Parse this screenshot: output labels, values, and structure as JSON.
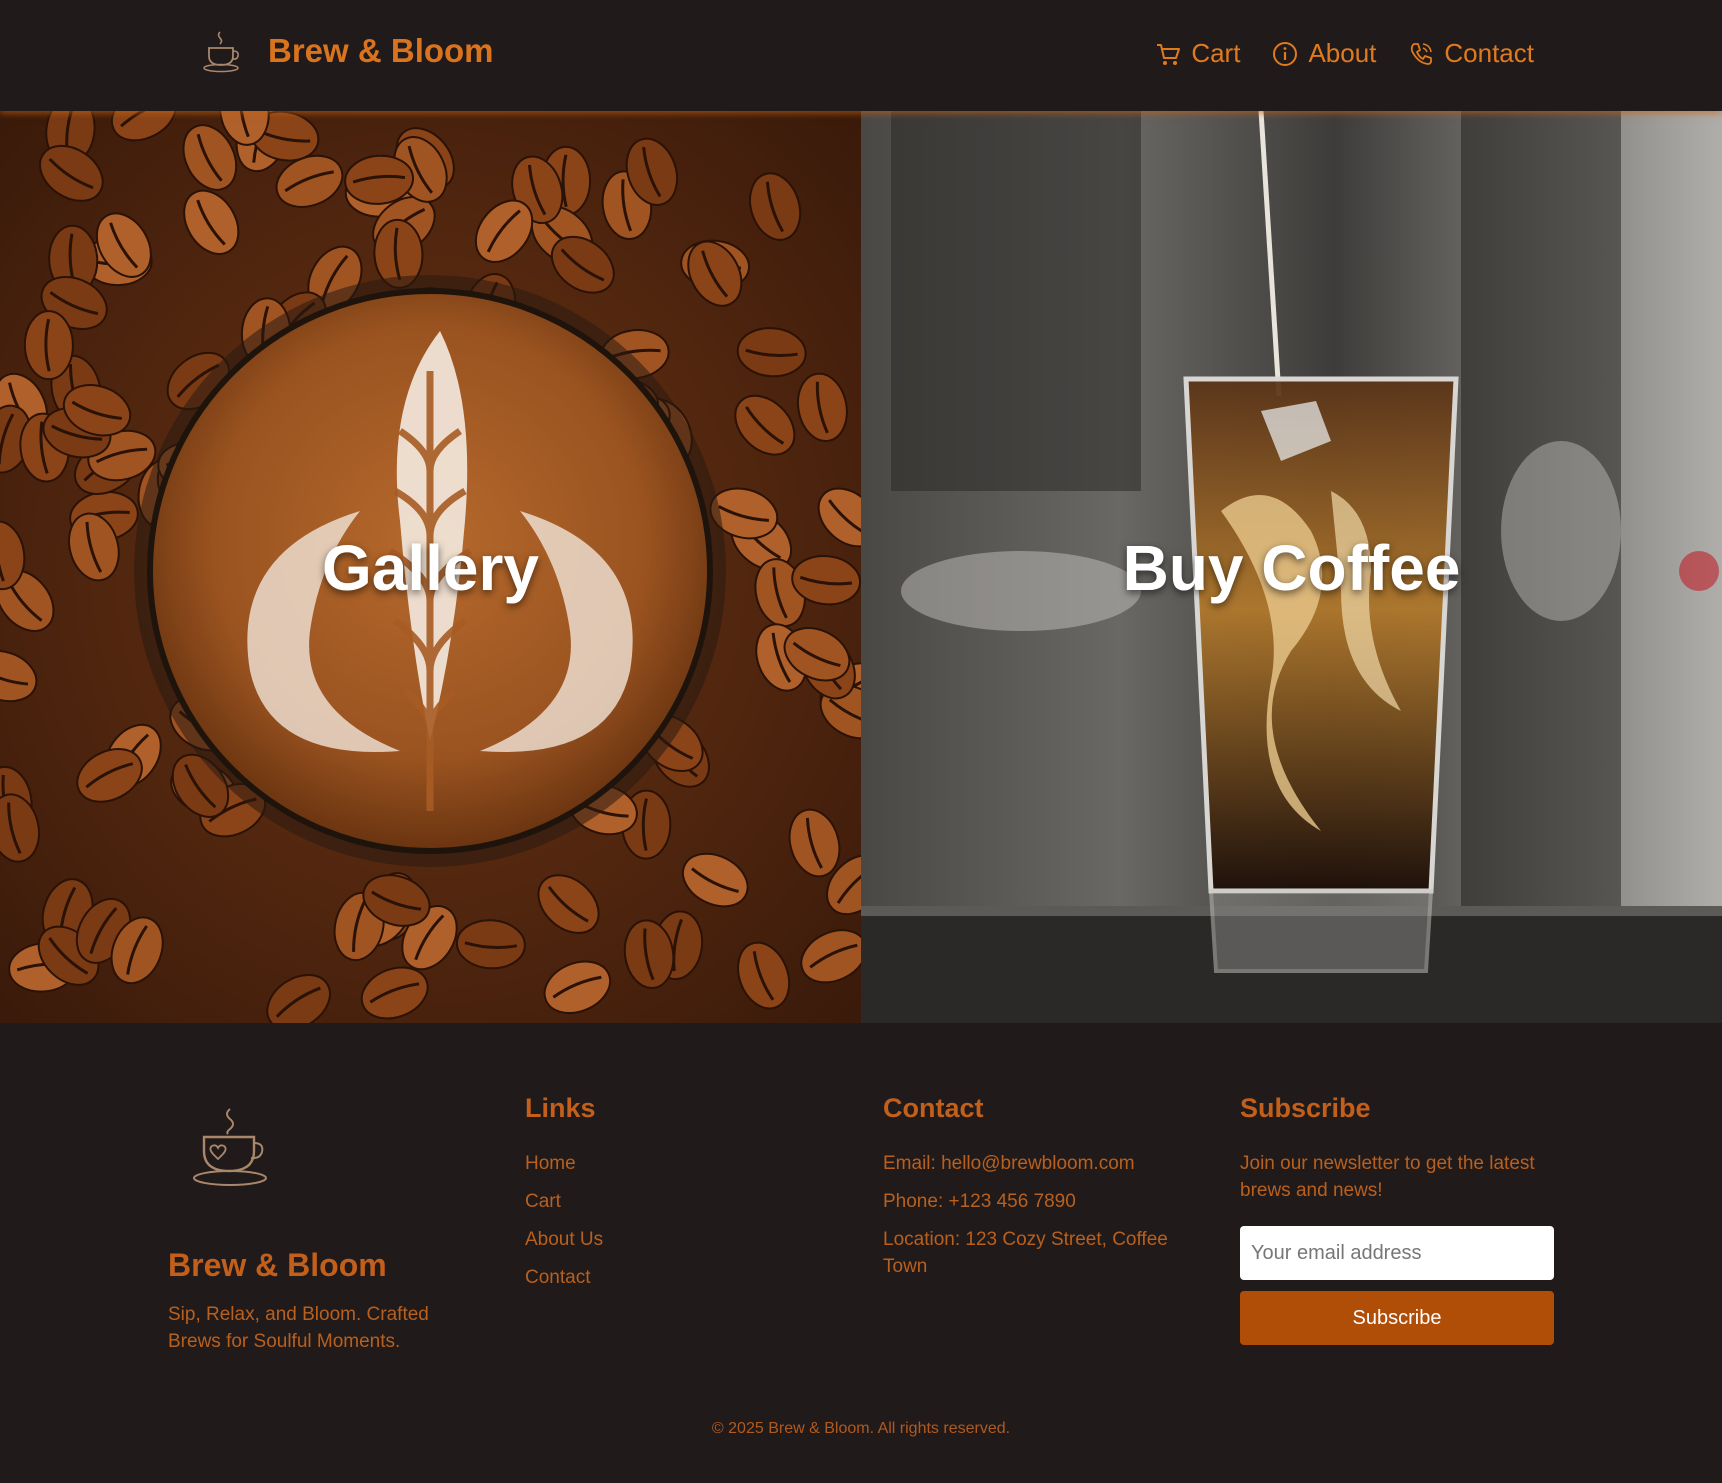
{
  "header": {
    "brand_name": "Brew & Bloom",
    "nav": [
      {
        "label": "Cart",
        "icon": "cart-icon"
      },
      {
        "label": "About",
        "icon": "info-icon"
      },
      {
        "label": "Contact",
        "icon": "phone-icon"
      }
    ]
  },
  "hero": {
    "panels": [
      {
        "title": "Gallery",
        "image": "latte-art-coffee-beans"
      },
      {
        "title": "Buy Coffee",
        "image": "iced-coffee-glass"
      }
    ]
  },
  "footer": {
    "brand_name": "Brew & Bloom",
    "tagline": "Sip, Relax, and Bloom. Crafted Brews for Soulful Moments.",
    "links": {
      "heading": "Links",
      "items": [
        "Home",
        "Cart",
        "About Us",
        "Contact"
      ]
    },
    "contact": {
      "heading": "Contact",
      "email": "Email: hello@brewbloom.com",
      "phone": "Phone: +123 456 7890",
      "location": "Location: 123 Cozy Street, Coffee Town"
    },
    "subscribe": {
      "heading": "Subscribe",
      "text": "Join our newsletter to get the latest brews and news!",
      "placeholder": "Your email address",
      "button_label": "Subscribe"
    },
    "copyright": "© 2025 Brew & Bloom. All rights reserved."
  },
  "colors": {
    "background": "#211a1a",
    "accent": "#d9731e",
    "button": "#b04e08"
  }
}
